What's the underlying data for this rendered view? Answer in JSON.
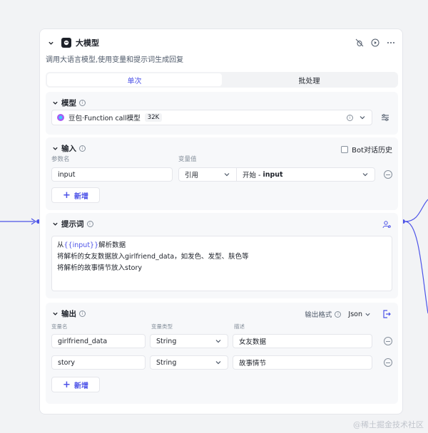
{
  "node": {
    "title": "大模型",
    "description": "调用大语言模型,使用变量和提示词生成回复",
    "tabs": [
      {
        "label": "单次"
      },
      {
        "label": "批处理"
      }
    ]
  },
  "model_section": {
    "title": "模型",
    "model_name": "豆包·Function call模型",
    "context_badge": "32K"
  },
  "input_section": {
    "title": "输入",
    "bot_history_label": "Bot对话历史",
    "col_name": "参数名",
    "col_value": "变量值",
    "row": {
      "name": "input",
      "mode": "引用",
      "ref_prefix": "开始 - ",
      "ref_var": "input"
    },
    "add_label": "新增"
  },
  "prompt_section": {
    "title": "提示词",
    "lines": [
      {
        "pre": "从",
        "var": "{{input}}",
        "post": "解析数据"
      },
      {
        "pre": "将解析的女友数据放入girlfriend_data，如发色、发型、肤色等",
        "var": "",
        "post": ""
      },
      {
        "pre": "将解析的故事情节放入story",
        "var": "",
        "post": ""
      }
    ]
  },
  "output_section": {
    "title": "输出",
    "format_label": "输出格式",
    "format_value": "Json",
    "col_name": "变量名",
    "col_type": "变量类型",
    "col_desc": "描述",
    "rows": [
      {
        "name": "girlfriend_data",
        "type": "String",
        "desc": "女友数据"
      },
      {
        "name": "story",
        "type": "String",
        "desc": "故事情节"
      }
    ],
    "add_label": "新增"
  },
  "watermark": "@稀土掘金技术社区",
  "colors": {
    "accent": "#4d53e8",
    "section_bg": "#f7f8fa",
    "page_bg": "#f2f3f5"
  }
}
